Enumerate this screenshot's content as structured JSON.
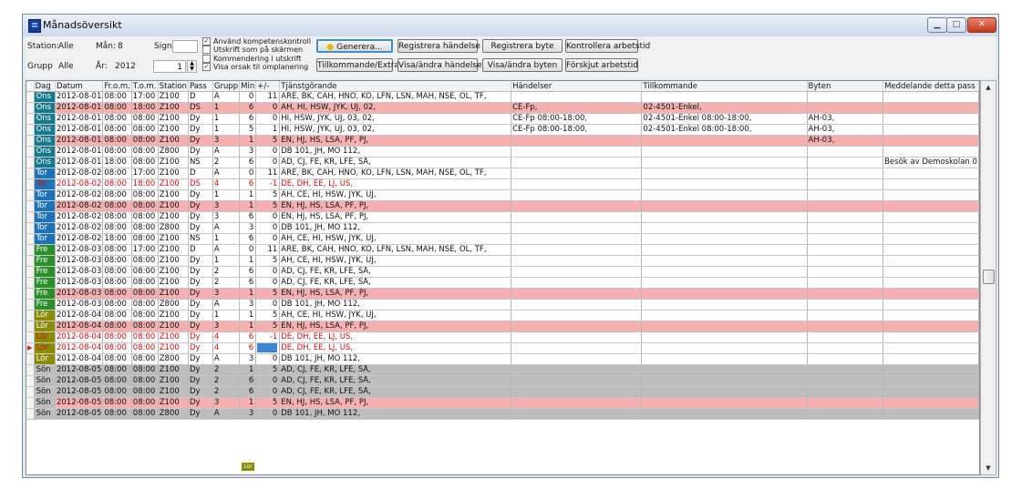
{
  "window": {
    "title": "Månadsöversikt"
  },
  "titlebar_buttons": {
    "min": "▁",
    "max": "□",
    "close": "✕"
  },
  "filters": {
    "station_label": "Station:",
    "station_value": "Alle",
    "man_label": "Mån:",
    "man_value": "8",
    "sign_label": "Sign",
    "grupp_label": "Grupp",
    "grupp_value": "Alle",
    "ar_label": "År:",
    "ar_value": "2012",
    "spin_value": "1"
  },
  "checkboxes": [
    {
      "label": "Använd kompetenskontroll",
      "checked": true
    },
    {
      "label": "Utskrift som på skärmen",
      "checked": false
    },
    {
      "label": "Kommendering i utskrift",
      "checked": false
    },
    {
      "label": "Visa orsak til omplanering",
      "checked": true
    }
  ],
  "buttons": {
    "generera": "Generera...",
    "registrera_handelse": "Registrera händelse",
    "registrera_byte": "Registrera byte",
    "kontrollera": "Kontrollera arbetstid",
    "tillkommande": "Tillkommande/Extra",
    "visa_handelser": "Visa/ändra händelser",
    "visa_byten": "Visa/ändra byten",
    "forskjut": "Förskjut arbetstid"
  },
  "colors": {
    "ons": "#157a8c",
    "tor": "#1c73b7",
    "fre": "#2a8f2a",
    "lor": "#8a8c00",
    "son": "#bdbdbd",
    "pink": "#f7b0b0"
  },
  "grid": {
    "columns": [
      "Dag",
      "Datum",
      "Fr.o.m.",
      "T.o.m.",
      "Station",
      "Pass",
      "Grupp",
      "Min",
      "+/-",
      "Tjänstgörande",
      "Händelser",
      "Tillkommande",
      "Byten",
      "Meddelande detta pass"
    ],
    "rows": [
      {
        "dag": "Ons",
        "datum": "2012-08-01",
        "from": "08:00",
        "tom": "17:00",
        "station": "Z100",
        "pass": "D",
        "grupp": "A",
        "min": "0",
        "pm": "11",
        "tj": "ARE, BK, CAH, HNO, KO, LFN, LSN, MAH, NSE, OL, TF,",
        "hand": "",
        "till": "",
        "byten": "",
        "medd": "",
        "style": ""
      },
      {
        "dag": "Ons",
        "datum": "2012-08-01",
        "from": "08:00",
        "tom": "18:00",
        "station": "Z100",
        "pass": "DS",
        "grupp": "1",
        "min": "6",
        "pm": "0",
        "tj": "AH, HI, HSW, JYK, UJ, 02,",
        "hand": "CE-Fp,",
        "till": "02-4501-Enkel,",
        "byten": "",
        "medd": "",
        "style": "pink"
      },
      {
        "dag": "Ons",
        "datum": "2012-08-01",
        "from": "08:00",
        "tom": "08:00",
        "station": "Z100",
        "pass": "Dy",
        "grupp": "1",
        "min": "6",
        "pm": "0",
        "tj": "HI, HSW, JYK, UJ, 03, 02,",
        "hand": "CE-Fp 08:00-18:00,",
        "till": "02-4501-Enkel 08:00-18:00,",
        "byten": "AH-03,",
        "medd": "",
        "style": ""
      },
      {
        "dag": "Ons",
        "datum": "2012-08-01",
        "from": "08:00",
        "tom": "08:00",
        "station": "Z100",
        "pass": "Dy",
        "grupp": "1",
        "min": "5",
        "pm": "1",
        "tj": "HI, HSW, JYK, UJ, 03, 02,",
        "hand": "CE-Fp 08:00-18:00,",
        "till": "02-4501-Enkel 08:00-18:00,",
        "byten": "AH-03,",
        "medd": "",
        "style": ""
      },
      {
        "dag": "Ons",
        "datum": "2012-08-01",
        "from": "08:00",
        "tom": "08:00",
        "station": "Z100",
        "pass": "Dy",
        "grupp": "3",
        "min": "1",
        "pm": "5",
        "tj": "EN, HJ, HS, LSA, PF, PJ,",
        "hand": "",
        "till": "",
        "byten": "AH-03,",
        "medd": "",
        "style": "pink"
      },
      {
        "dag": "Ons",
        "datum": "2012-08-01",
        "from": "08:00",
        "tom": "08:00",
        "station": "Z800",
        "pass": "Dy",
        "grupp": "A",
        "min": "3",
        "pm": "0",
        "tj": "DB 101, JH, MÖ 112,",
        "hand": "",
        "till": "",
        "byten": "",
        "medd": "",
        "style": ""
      },
      {
        "dag": "Ons",
        "datum": "2012-08-01",
        "from": "18:00",
        "tom": "08:00",
        "station": "Z100",
        "pass": "NS",
        "grupp": "2",
        "min": "6",
        "pm": "0",
        "tj": "AD, CJ, FE, KR, LFE, SÅ,",
        "hand": "",
        "till": "",
        "byten": "",
        "medd": "Besök av Demoskolan 0",
        "style": ""
      },
      {
        "dag": "Tor",
        "datum": "2012-08-02",
        "from": "08:00",
        "tom": "17:00",
        "station": "Z100",
        "pass": "D",
        "grupp": "A",
        "min": "0",
        "pm": "11",
        "tj": "ARE, BK, CAH, HNO, KO, LFN, LSN, MAH, NSE, OL, TF,",
        "hand": "",
        "till": "",
        "byten": "",
        "medd": "",
        "style": ""
      },
      {
        "dag": "Tor",
        "datum": "2012-08-02",
        "from": "08:00",
        "tom": "18:00",
        "station": "Z100",
        "pass": "DS",
        "grupp": "4",
        "min": "6",
        "pm": "-1",
        "tj": "DE, DH, EE, LJ, US,",
        "hand": "",
        "till": "",
        "byten": "",
        "medd": "",
        "style": "red"
      },
      {
        "dag": "Tor",
        "datum": "2012-08-02",
        "from": "08:00",
        "tom": "08:00",
        "station": "Z100",
        "pass": "Dy",
        "grupp": "1",
        "min": "1",
        "pm": "5",
        "tj": "AH, CE, HI, HSW, JYK, UJ,",
        "hand": "",
        "till": "",
        "byten": "",
        "medd": "",
        "style": ""
      },
      {
        "dag": "Tor",
        "datum": "2012-08-02",
        "from": "08:00",
        "tom": "08:00",
        "station": "Z100",
        "pass": "Dy",
        "grupp": "3",
        "min": "1",
        "pm": "5",
        "tj": "EN, HJ, HS, LSA, PF, PJ,",
        "hand": "",
        "till": "",
        "byten": "",
        "medd": "",
        "style": "pink"
      },
      {
        "dag": "Tor",
        "datum": "2012-08-02",
        "from": "08:00",
        "tom": "08:00",
        "station": "Z100",
        "pass": "Dy",
        "grupp": "3",
        "min": "6",
        "pm": "0",
        "tj": "EN, HJ, HS, LSA, PF, PJ,",
        "hand": "",
        "till": "",
        "byten": "",
        "medd": "",
        "style": ""
      },
      {
        "dag": "Tor",
        "datum": "2012-08-02",
        "from": "08:00",
        "tom": "08:00",
        "station": "Z800",
        "pass": "Dy",
        "grupp": "A",
        "min": "3",
        "pm": "0",
        "tj": "DB 101, JH, MÖ 112,",
        "hand": "",
        "till": "",
        "byten": "",
        "medd": "",
        "style": ""
      },
      {
        "dag": "Tor",
        "datum": "2012-08-02",
        "from": "18:00",
        "tom": "08:00",
        "station": "Z100",
        "pass": "NS",
        "grupp": "1",
        "min": "6",
        "pm": "0",
        "tj": "AH, CE, HI, HSW, JYK, UJ,",
        "hand": "",
        "till": "",
        "byten": "",
        "medd": "",
        "style": ""
      },
      {
        "dag": "Fre",
        "datum": "2012-08-03",
        "from": "08:00",
        "tom": "17:00",
        "station": "Z100",
        "pass": "D",
        "grupp": "A",
        "min": "0",
        "pm": "11",
        "tj": "ARE, BK, CAH, HNO, KO, LFN, LSN, MAH, NSE, OL, TF,",
        "hand": "",
        "till": "",
        "byten": "",
        "medd": "",
        "style": ""
      },
      {
        "dag": "Fre",
        "datum": "2012-08-03",
        "from": "08:00",
        "tom": "08:00",
        "station": "Z100",
        "pass": "Dy",
        "grupp": "1",
        "min": "1",
        "pm": "5",
        "tj": "AH, CE, HI, HSW, JYK, UJ,",
        "hand": "",
        "till": "",
        "byten": "",
        "medd": "",
        "style": ""
      },
      {
        "dag": "Fre",
        "datum": "2012-08-03",
        "from": "08:00",
        "tom": "08:00",
        "station": "Z100",
        "pass": "Dy",
        "grupp": "2",
        "min": "6",
        "pm": "0",
        "tj": "AD, CJ, FE, KR, LFE, SÅ,",
        "hand": "",
        "till": "",
        "byten": "",
        "medd": "",
        "style": ""
      },
      {
        "dag": "Fre",
        "datum": "2012-08-03",
        "from": "08:00",
        "tom": "08:00",
        "station": "Z100",
        "pass": "Dy",
        "grupp": "2",
        "min": "6",
        "pm": "0",
        "tj": "AD, CJ, FE, KR, LFE, SÅ,",
        "hand": "",
        "till": "",
        "byten": "",
        "medd": "",
        "style": ""
      },
      {
        "dag": "Fre",
        "datum": "2012-08-03",
        "from": "08:00",
        "tom": "08:00",
        "station": "Z100",
        "pass": "Dy",
        "grupp": "3",
        "min": "1",
        "pm": "5",
        "tj": "EN, HJ, HS, LSA, PF, PJ,",
        "hand": "",
        "till": "",
        "byten": "",
        "medd": "",
        "style": "pink"
      },
      {
        "dag": "Fre",
        "datum": "2012-08-03",
        "from": "08:00",
        "tom": "08:00",
        "station": "Z800",
        "pass": "Dy",
        "grupp": "A",
        "min": "3",
        "pm": "0",
        "tj": "DB 101, JH, MÖ 112,",
        "hand": "",
        "till": "",
        "byten": "",
        "medd": "",
        "style": ""
      },
      {
        "dag": "Lör",
        "datum": "2012-08-04",
        "from": "08:00",
        "tom": "08:00",
        "station": "Z100",
        "pass": "Dy",
        "grupp": "1",
        "min": "1",
        "pm": "5",
        "tj": "AH, CE, HI, HSW, JYK, UJ,",
        "hand": "",
        "till": "",
        "byten": "",
        "medd": "",
        "style": ""
      },
      {
        "dag": "Lör",
        "datum": "2012-08-04",
        "from": "08:00",
        "tom": "08:00",
        "station": "Z100",
        "pass": "Dy",
        "grupp": "3",
        "min": "1",
        "pm": "5",
        "tj": "EN, HJ, HS, LSA, PF, PJ,",
        "hand": "",
        "till": "",
        "byten": "",
        "medd": "",
        "style": "pink"
      },
      {
        "dag": "Lör",
        "datum": "2012-08-04",
        "from": "08:00",
        "tom": "08:00",
        "station": "Z100",
        "pass": "Dy",
        "grupp": "4",
        "min": "6",
        "pm": "-1",
        "tj": "DE, DH, EE, LJ, US,",
        "hand": "",
        "till": "",
        "byten": "",
        "medd": "",
        "style": "red"
      },
      {
        "dag": "Lör",
        "datum": "2012-08-04",
        "from": "08:00",
        "tom": "08:00",
        "station": "Z100",
        "pass": "Dy",
        "grupp": "4",
        "min": "6",
        "pm": "",
        "tj": "DE, DH, EE, LJ, US,",
        "hand": "",
        "till": "",
        "byten": "",
        "medd": "",
        "style": "red",
        "selected": true
      },
      {
        "dag": "Lör",
        "datum": "2012-08-04",
        "from": "08:00",
        "tom": "08:00",
        "station": "Z800",
        "pass": "Dy",
        "grupp": "A",
        "min": "3",
        "pm": "0",
        "tj": "DB 101, JH, MÖ 112,",
        "hand": "",
        "till": "",
        "byten": "",
        "medd": "",
        "style": ""
      },
      {
        "dag": "Sön",
        "datum": "2012-08-05",
        "from": "08:00",
        "tom": "08:00",
        "station": "Z100",
        "pass": "Dy",
        "grupp": "2",
        "min": "1",
        "pm": "5",
        "tj": "AD, CJ, FE, KR, LFE, SÅ,",
        "hand": "",
        "till": "",
        "byten": "",
        "medd": "",
        "style": "gray"
      },
      {
        "dag": "Sön",
        "datum": "2012-08-05",
        "from": "08:00",
        "tom": "08:00",
        "station": "Z100",
        "pass": "Dy",
        "grupp": "2",
        "min": "6",
        "pm": "0",
        "tj": "AD, CJ, FE, KR, LFE, SÅ,",
        "hand": "",
        "till": "",
        "byten": "",
        "medd": "",
        "style": "gray"
      },
      {
        "dag": "Sön",
        "datum": "2012-08-05",
        "from": "08:00",
        "tom": "08:00",
        "station": "Z100",
        "pass": "Dy",
        "grupp": "2",
        "min": "6",
        "pm": "0",
        "tj": "AD, CJ, FE, KR, LFE, SÅ,",
        "hand": "",
        "till": "",
        "byten": "",
        "medd": "",
        "style": "gray"
      },
      {
        "dag": "Sön",
        "datum": "2012-08-05",
        "from": "08:00",
        "tom": "08:00",
        "station": "Z100",
        "pass": "Dy",
        "grupp": "3",
        "min": "1",
        "pm": "5",
        "tj": "EN, HJ, HS, LSA, PF, PJ,",
        "hand": "",
        "till": "",
        "byten": "",
        "medd": "",
        "style": "pink"
      },
      {
        "dag": "Sön",
        "datum": "2012-08-05",
        "from": "08:00",
        "tom": "08:00",
        "station": "Z800",
        "pass": "Dy",
        "grupp": "A",
        "min": "3",
        "pm": "0",
        "tj": "DB 101, JH, MÖ 112,",
        "hand": "",
        "till": "",
        "byten": "",
        "medd": "",
        "style": "gray"
      }
    ],
    "bottom_tag": "Lör"
  },
  "scrollbar": {
    "up": "▲",
    "down": "▼"
  }
}
